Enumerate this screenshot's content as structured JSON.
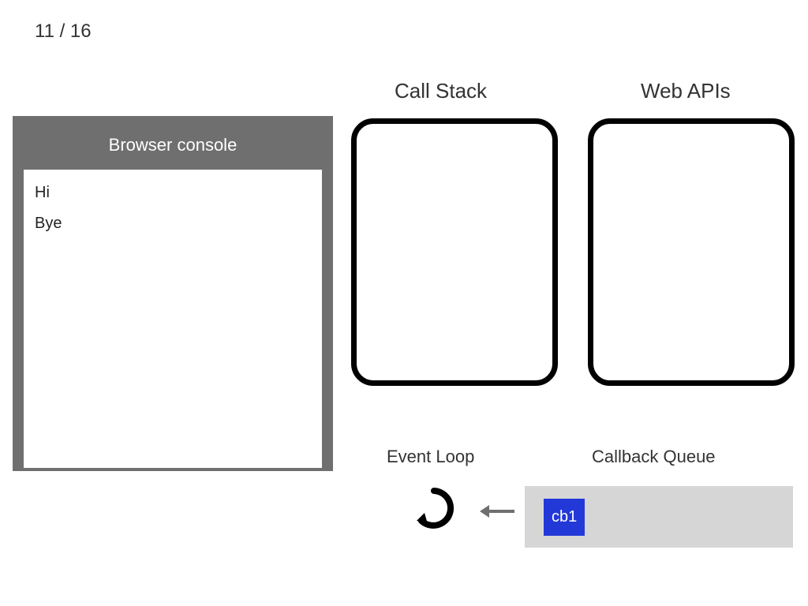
{
  "page_counter": {
    "current": 11,
    "total": 16,
    "display": "11 / 16"
  },
  "labels": {
    "call_stack": "Call Stack",
    "web_apis": "Web APIs",
    "event_loop": "Event Loop",
    "callback_queue": "Callback Queue"
  },
  "browser_console": {
    "title": "Browser console",
    "lines": [
      "Hi",
      "Bye"
    ]
  },
  "call_stack": {
    "items": []
  },
  "web_apis": {
    "items": []
  },
  "callback_queue": {
    "items": [
      "cb1"
    ]
  },
  "colors": {
    "console_frame": "#6f6f6f",
    "queue_bg": "#d6d6d6",
    "callback_item": "#2239d8"
  }
}
